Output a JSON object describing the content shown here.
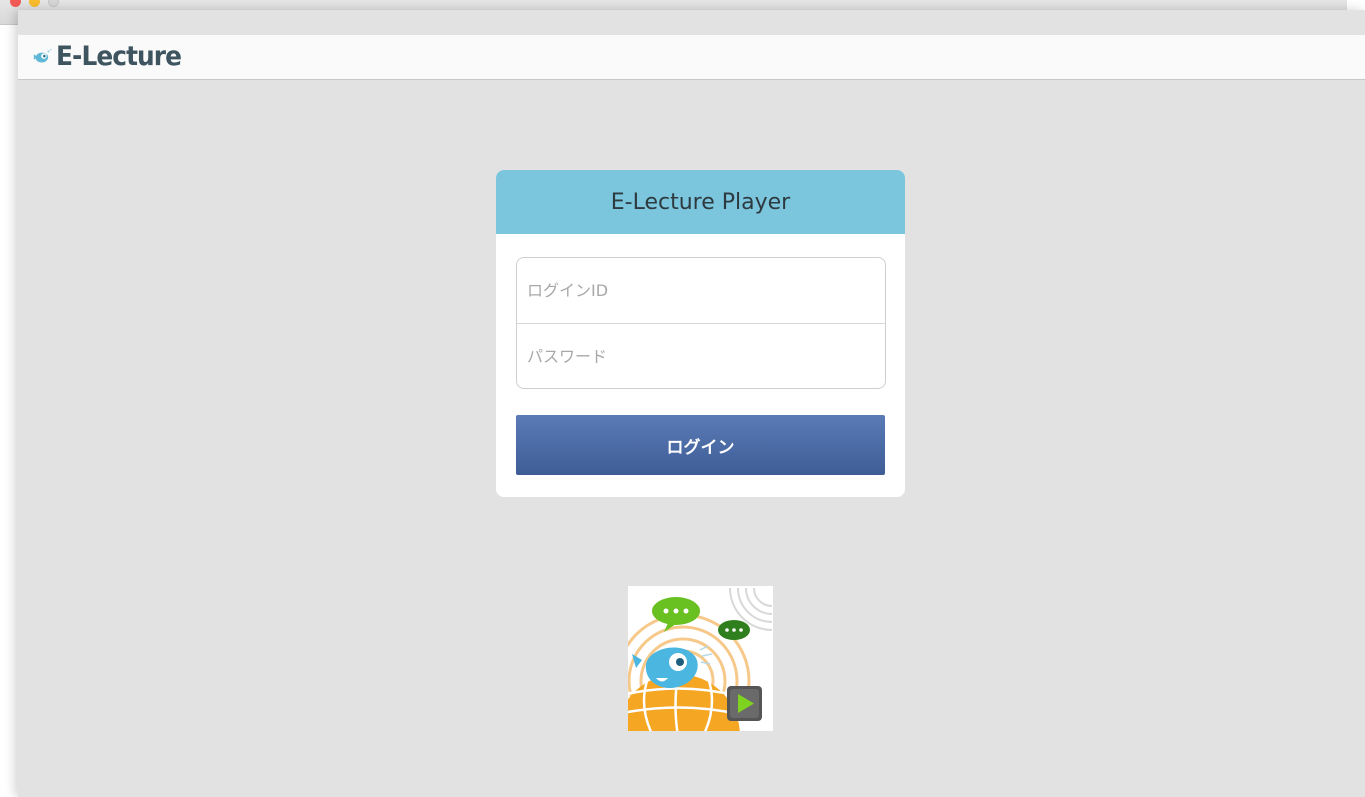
{
  "app": {
    "brand_name": "E-Lecture"
  },
  "login": {
    "title": "E-Lecture Player",
    "login_id_placeholder": "ログインID",
    "password_placeholder": "パスワード",
    "submit_label": "ログイン"
  },
  "icons": {
    "brand": "fish-logo-icon",
    "app_logo": "e-lecture-app-icon"
  },
  "colors": {
    "header": "#7cc6dd",
    "button": "#4a6aa6",
    "background": "#e2e2e2"
  }
}
